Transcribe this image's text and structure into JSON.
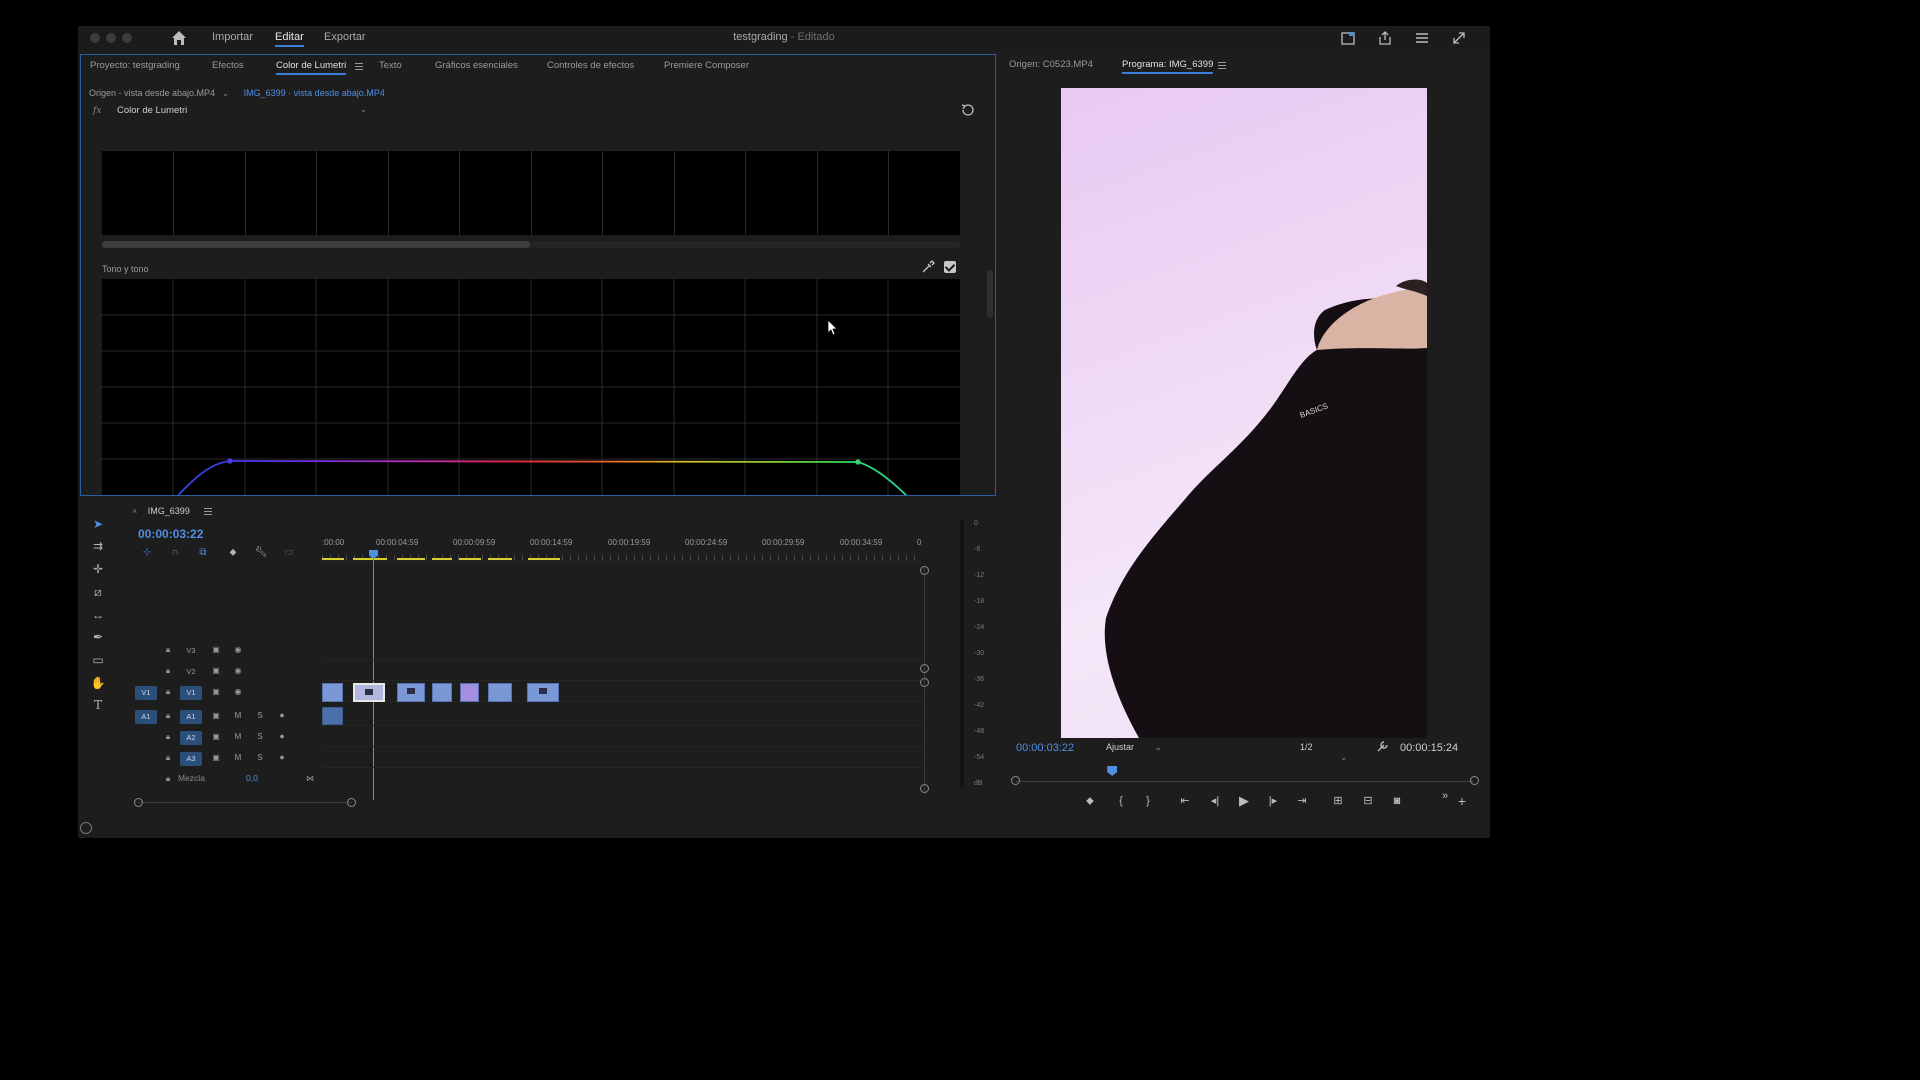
{
  "titlebar": {
    "tabs": [
      "Importar",
      "Editar",
      "Exportar"
    ],
    "active_tab": "Editar",
    "doc_name": "testgrading",
    "doc_state": " - Editado"
  },
  "lumetri": {
    "tabs": [
      "Proyecto: testgrading",
      "Efectos",
      "Color de Lumetri",
      "Texto",
      "Gráficos esenciales",
      "Controles de efectos",
      "Premiere Composer"
    ],
    "active_tab": "Color de Lumetri",
    "source_label": "Origen - vista desde abajo.MP4",
    "sequence_clip": "IMG_6399 · vista desde abajo.MP4",
    "fx_label": "fx",
    "effect_name": "Color de Lumetri",
    "section_label": "Tono y tono",
    "curve_points": {
      "left_handle": "hue",
      "right_handle": "green"
    }
  },
  "monitor": {
    "tabs": [
      "Origen: C0523.MP4",
      "Programa: IMG_6399"
    ],
    "active_tab": "Programa: IMG_6399",
    "current_time": "00:00:03:22",
    "fit": "Ajustar",
    "resolution": "1/2",
    "duration": "00:00:15:24",
    "playhead_fraction": 0.21
  },
  "timeline": {
    "sequence_name": "IMG_6399",
    "current_time": "00:00:03:22",
    "ruler_labels": [
      ":00:00",
      "00:00:04:59",
      "00:00:09:59",
      "00:00:14:59",
      "00:00:19:59",
      "00:00:24:59",
      "00:00:29:59",
      "00:00:34:59",
      "0"
    ],
    "video_tracks": [
      {
        "name": "V3",
        "target": ""
      },
      {
        "name": "V2",
        "target": ""
      },
      {
        "name": "V1",
        "target": "V1"
      }
    ],
    "audio_tracks": [
      {
        "name": "A1",
        "target": "A1",
        "m": "M",
        "s": "S"
      },
      {
        "name": "A2",
        "target": "",
        "m": "M",
        "s": "S"
      },
      {
        "name": "A3",
        "target": "",
        "m": "M",
        "s": "S"
      }
    ],
    "mix_label": "Mezcla",
    "mix_value": "0,0"
  },
  "meter": {
    "labels": [
      "0",
      "-6",
      "-12",
      "-18",
      "-24",
      "-30",
      "-36",
      "-42",
      "-48",
      "-54",
      "dB"
    ]
  },
  "colors": {
    "accent": "#4f8fe3",
    "panel_border": "#2c5f9e",
    "clip": "#7a97d6",
    "work_area": "#d6cf2c"
  },
  "video": {
    "shirt_text": "BASICS"
  }
}
